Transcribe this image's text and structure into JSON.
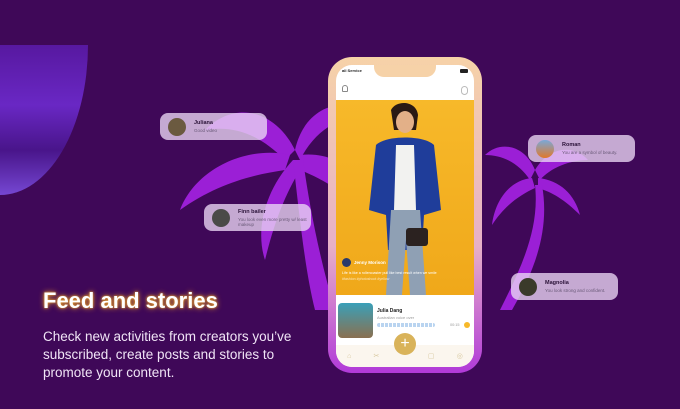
{
  "headline": "Feed and stories",
  "description": "Check new activities from creators you’ve subscribed, create posts and stories to promote your content.",
  "comments": [
    {
      "name": "Juliana",
      "message": "Good video"
    },
    {
      "name": "Finn bailer",
      "message": "You look even more pretty w/ least makeup"
    },
    {
      "name": "Roman",
      "message": "You are a symbol of beauty."
    },
    {
      "name": "Magnolia",
      "message": "You look strong and confident."
    }
  ],
  "phone": {
    "status": "all Service",
    "post": {
      "author": "Jenny Morison",
      "text": "Life is like a rollercoaster pull like best result when we smile",
      "tags": "#fashion #photoshoot #yellow"
    },
    "audio": {
      "name": "Julia Dang",
      "subtitle": "Australian voice over",
      "time": "00:15"
    },
    "nav": [
      "⌂",
      "✂",
      "+",
      "▢",
      "◎"
    ]
  },
  "colors": {
    "background": "#3f0858",
    "palm": "#9b1fd6",
    "accent": "#f7b92a"
  }
}
